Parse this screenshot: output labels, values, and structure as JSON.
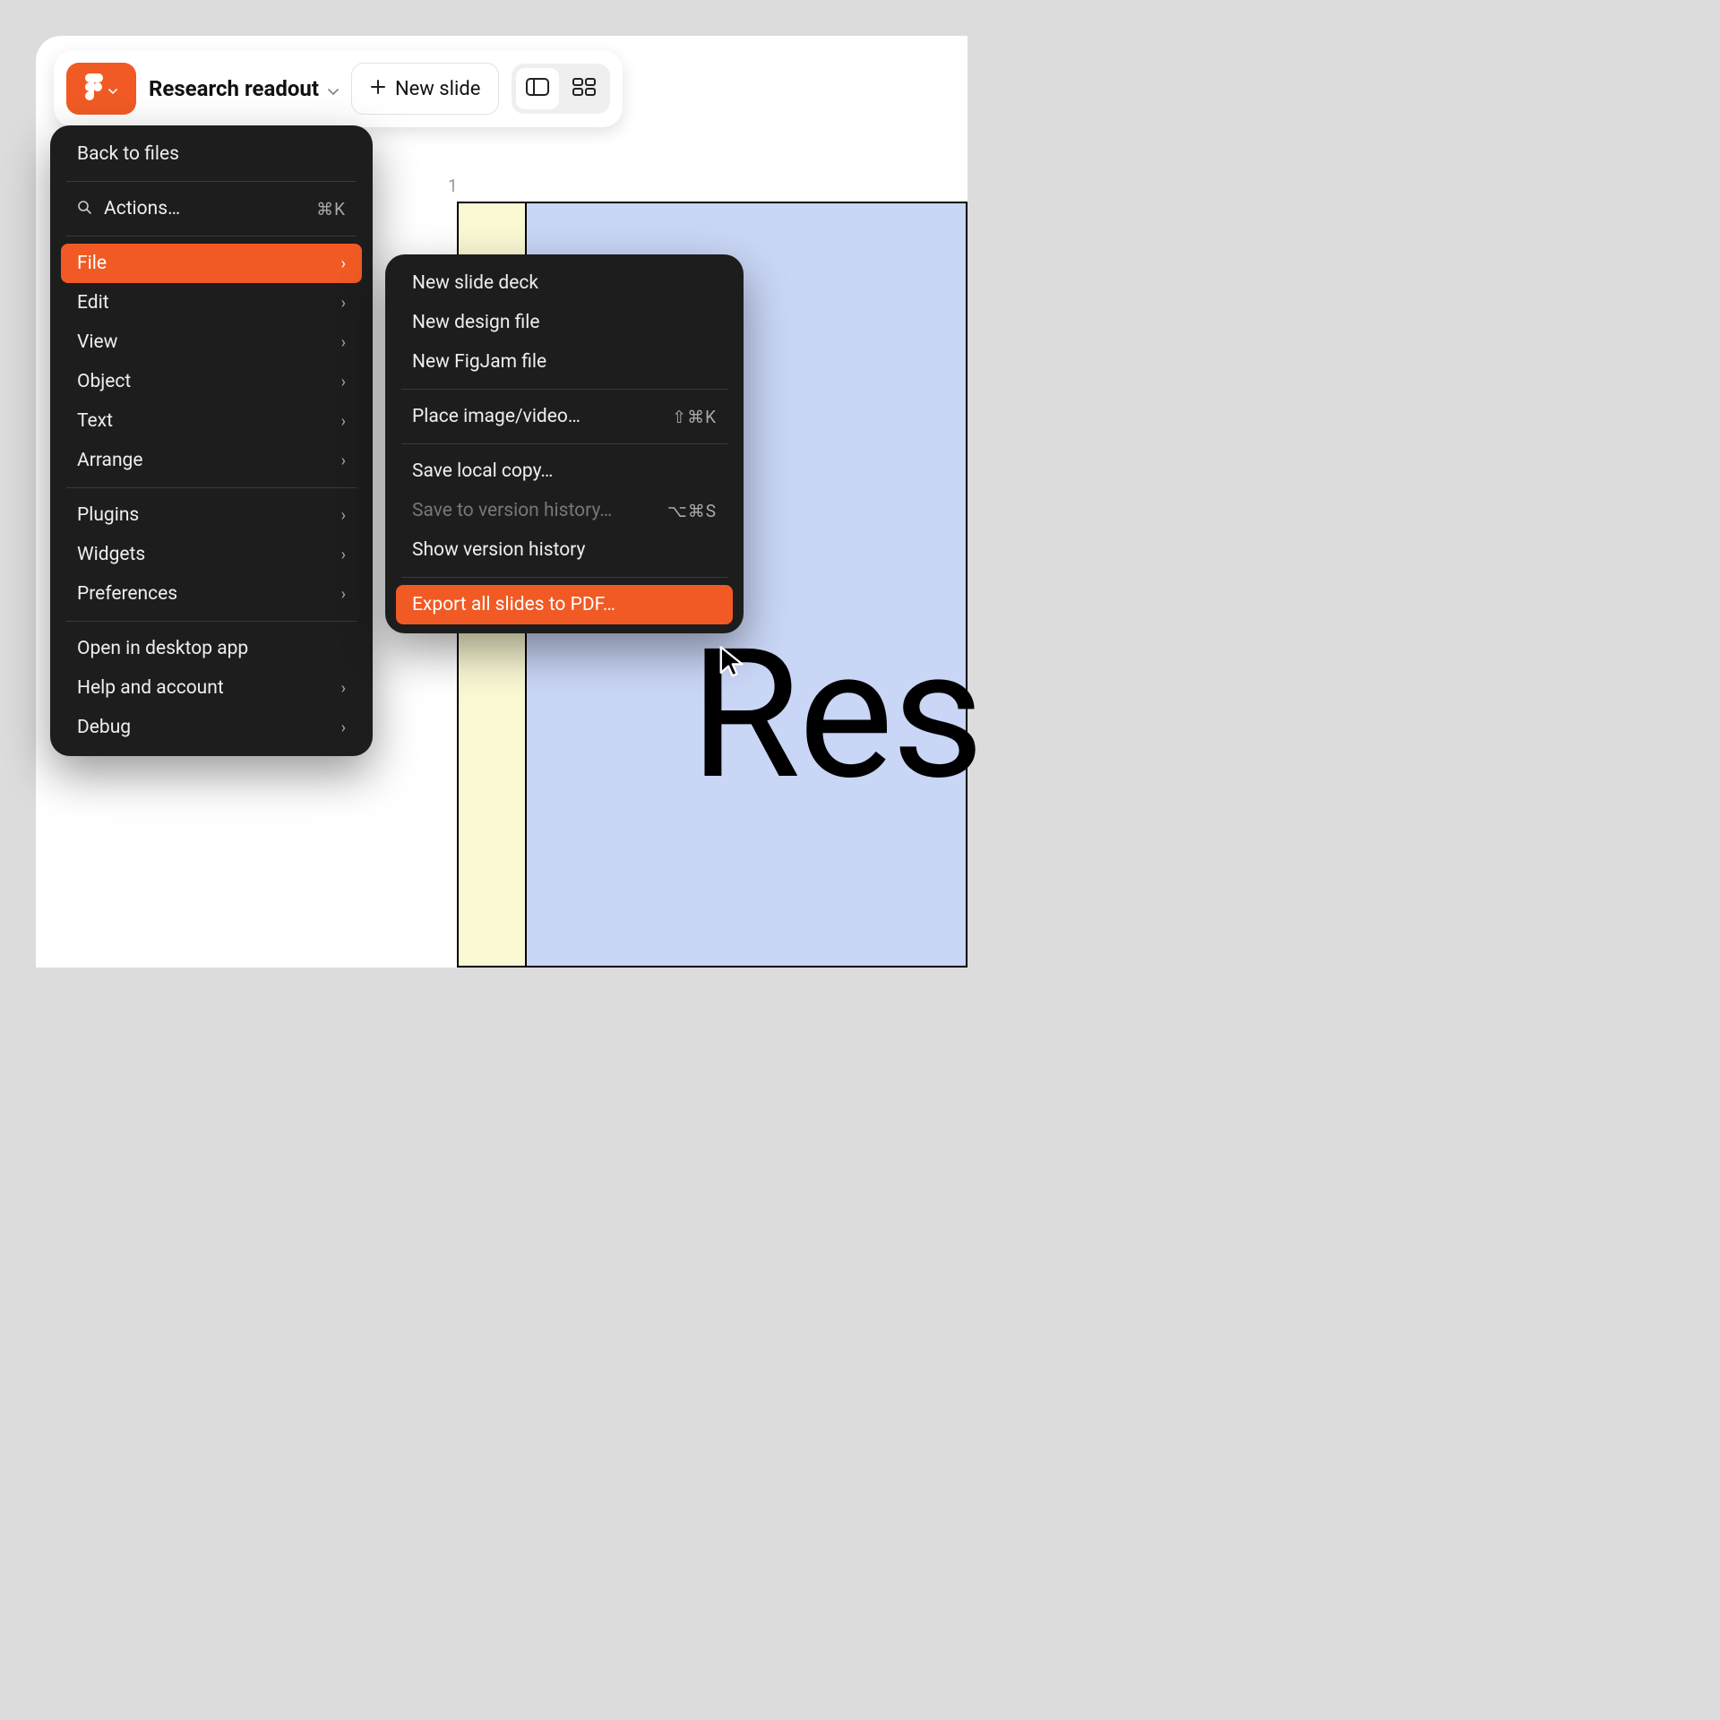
{
  "toolbar": {
    "doc_title": "Research readout",
    "new_slide_label": "New slide"
  },
  "slide": {
    "number": "1",
    "title_text": "Res"
  },
  "main_menu": {
    "back_to_files": "Back to files",
    "actions": "Actions…",
    "actions_shortcut": "⌘K",
    "file": "File",
    "edit": "Edit",
    "view": "View",
    "object": "Object",
    "text": "Text",
    "arrange": "Arrange",
    "plugins": "Plugins",
    "widgets": "Widgets",
    "preferences": "Preferences",
    "open_desktop": "Open in desktop app",
    "help_account": "Help and account",
    "debug": "Debug"
  },
  "file_submenu": {
    "new_slide_deck": "New slide deck",
    "new_design_file": "New design file",
    "new_figjam_file": "New FigJam file",
    "place_image_video": "Place image/video…",
    "place_shortcut": "⇧⌘K",
    "save_local": "Save local copy…",
    "save_version_history": "Save to version history…",
    "save_vh_shortcut": "⌥⌘S",
    "show_version_history": "Show version history",
    "export_pdf": "Export all slides to PDF…"
  },
  "colors": {
    "accent": "#f15a24",
    "menu_bg": "#1d1d1d"
  }
}
